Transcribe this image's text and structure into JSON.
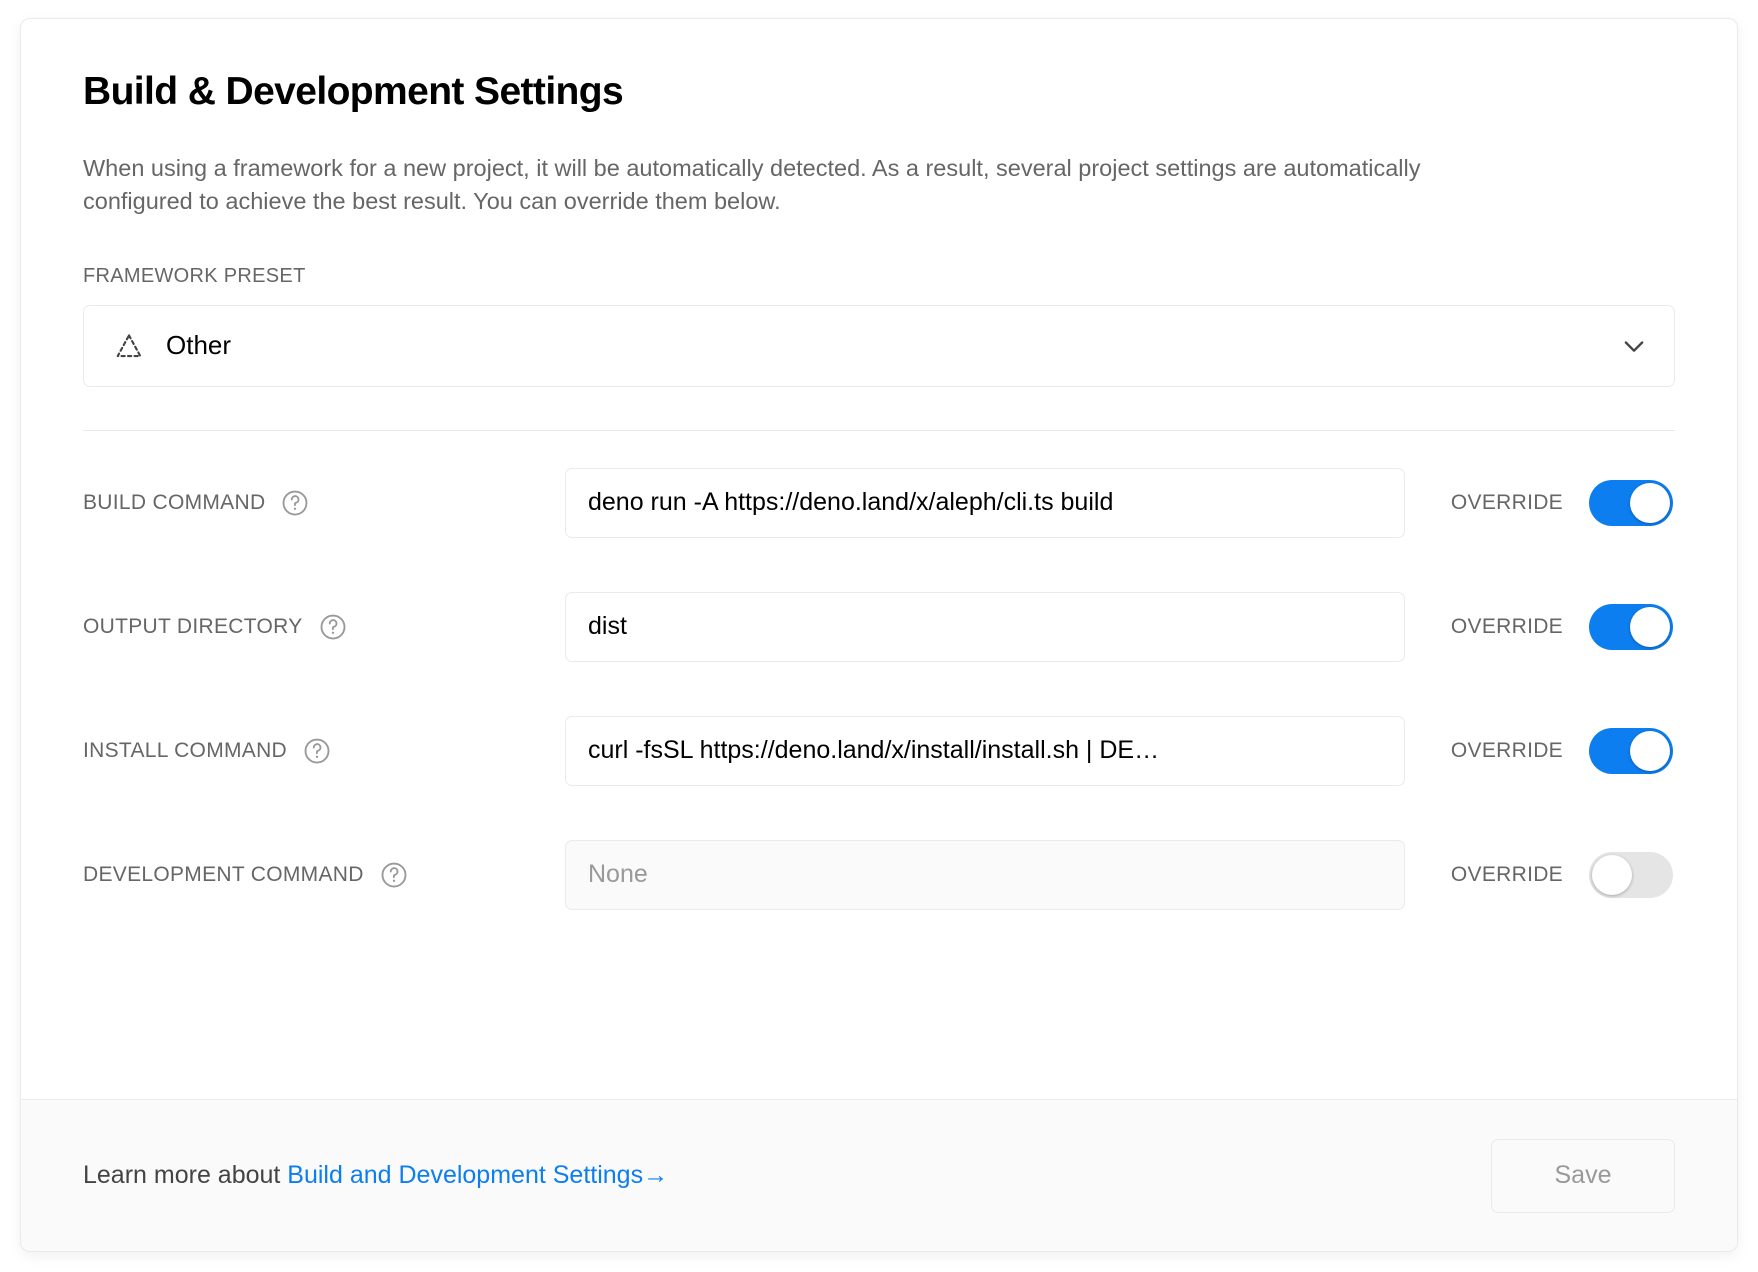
{
  "card": {
    "title": "Build & Development Settings",
    "description": "When using a framework for a new project, it will be automatically detected. As a result, several project settings are automatically configured to achieve the best result. You can override them below."
  },
  "framework_preset": {
    "label": "FRAMEWORK PRESET",
    "selected": "Other",
    "icon": "dashed-triangle-icon",
    "chevron": "chevron-down-icon"
  },
  "rows": [
    {
      "label": "BUILD COMMAND",
      "help_icon": "question-mark-circle-icon",
      "value": "deno run -A https://deno.land/x/aleph/cli.ts build",
      "placeholder": "",
      "override_label": "OVERRIDE",
      "override_on": true,
      "disabled": false
    },
    {
      "label": "OUTPUT DIRECTORY",
      "help_icon": "question-mark-circle-icon",
      "value": "dist",
      "placeholder": "",
      "override_label": "OVERRIDE",
      "override_on": true,
      "disabled": false
    },
    {
      "label": "INSTALL COMMAND",
      "help_icon": "question-mark-circle-icon",
      "value": "curl -fsSL https://deno.land/x/install/install.sh | DE…",
      "placeholder": "",
      "override_label": "OVERRIDE",
      "override_on": true,
      "disabled": false
    },
    {
      "label": "DEVELOPMENT COMMAND",
      "help_icon": "question-mark-circle-icon",
      "value": "",
      "placeholder": "None",
      "override_label": "OVERRIDE",
      "override_on": false,
      "disabled": true
    }
  ],
  "footer": {
    "learn_more_prefix": "Learn more about ",
    "link_text": "Build and Development Settings",
    "link_arrow": "→",
    "save_label": "Save"
  },
  "colors": {
    "accent": "#0d7ef0",
    "toggle_off": "#e5e5e5",
    "border": "#eaeaea",
    "muted_text": "#666666",
    "footer_bg": "#fafafa"
  }
}
